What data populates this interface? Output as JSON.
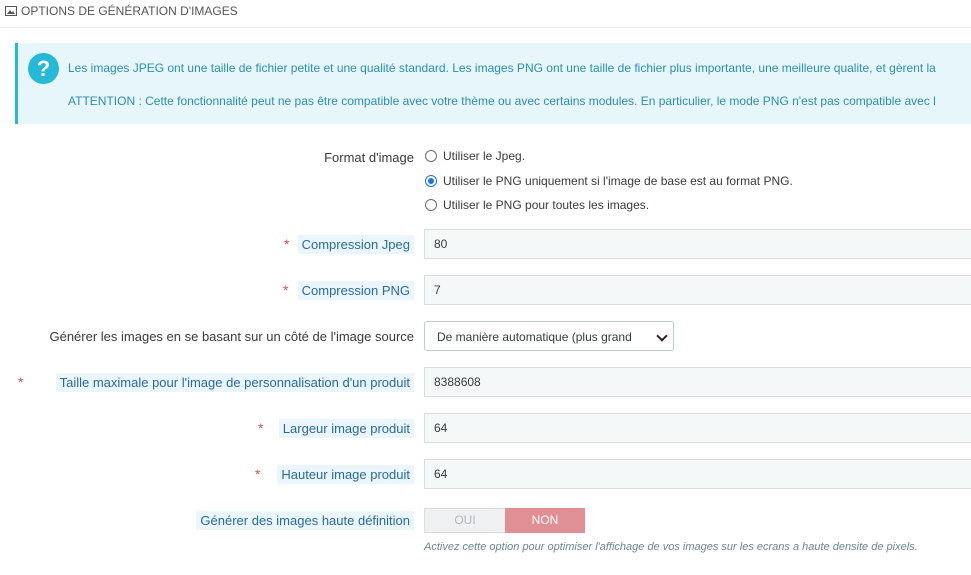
{
  "header": {
    "title": "OPTIONS DE GÉNÉRATION D'IMAGES",
    "icon": "image-icon"
  },
  "alert": {
    "icon": "question-icon",
    "line1": "Les images JPEG ont une taille de fichier petite et une qualité standard. Les images PNG ont une taille de fichier plus importante, une meilleure qualite, et gèrent la",
    "line2": "ATTENTION : Cette fonctionnalité peut ne pas être compatible avec votre thème ou avec certains modules. En particulier, le mode PNG n'est pas compatible avec l"
  },
  "format": {
    "label": "Format d'image",
    "options": [
      {
        "label": "Utiliser le Jpeg.",
        "selected": false
      },
      {
        "label": "Utiliser le PNG uniquement si l'image de base est au format PNG.",
        "selected": true
      },
      {
        "label": "Utiliser le PNG pour toutes les images.",
        "selected": false
      }
    ]
  },
  "jpeg": {
    "label": "Compression Jpeg",
    "value": "80"
  },
  "png": {
    "label": "Compression PNG",
    "value": "7"
  },
  "side": {
    "label": "Générer les images en se basant sur un côté de l'image source",
    "value": "De manière automatique (plus grand"
  },
  "maxsize": {
    "label": "Taille maximale pour l'image de personnalisation d'un produit",
    "value": "8388608"
  },
  "width": {
    "label": "Largeur image produit",
    "value": "64"
  },
  "height": {
    "label": "Hauteur image produit",
    "value": "64"
  },
  "hd": {
    "label": "Générer des images haute définition",
    "yes": "OUI",
    "no": "NON",
    "help": "Activez cette option pour optimiser l'affichage de vos images sur les ecrans a haute densite de pixels."
  },
  "required_mark": "*"
}
